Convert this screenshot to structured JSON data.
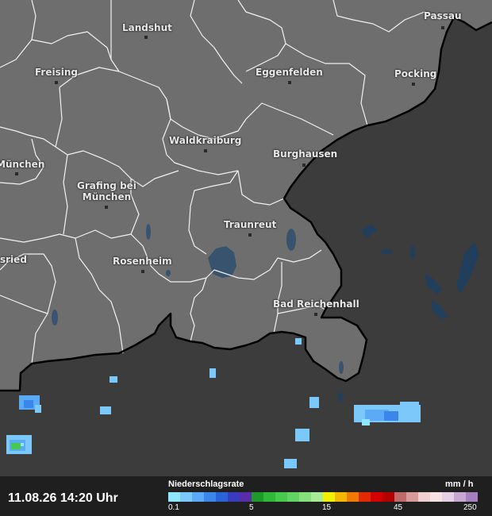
{
  "cities": [
    {
      "name": "Landshut",
      "id": "landshut"
    },
    {
      "name": "Passau",
      "id": "passau"
    },
    {
      "name": "Freising",
      "id": "freising"
    },
    {
      "name": "Eggenfelden",
      "id": "eggenfelden"
    },
    {
      "name": "Pocking",
      "id": "pocking"
    },
    {
      "name": "Waldkraiburg",
      "id": "waldkraiburg"
    },
    {
      "name": "Burghausen",
      "id": "burghausen"
    },
    {
      "name": "München",
      "id": "muenchen"
    },
    {
      "name": "Grafing bei\nMünchen",
      "id": "grafing"
    },
    {
      "name": "Traunreut",
      "id": "traunreut"
    },
    {
      "name": "Rosenheim",
      "id": "rosenheim"
    },
    {
      "name": "sried",
      "id": "sried"
    },
    {
      "name": "Bad Reichenhall",
      "id": "bad-reichenhall"
    }
  ],
  "footer": {
    "timestamp": "11.08.26 14:20 Uhr",
    "legend_title": "Niederschlagsrate",
    "legend_unit": "mm / h",
    "tick_labels": [
      "0.1",
      "5",
      "15",
      "45",
      "250"
    ],
    "swatches": [
      "#8fe6ff",
      "#7cc8fb",
      "#5aaaf5",
      "#3b86ea",
      "#2a62d9",
      "#3a3cc0",
      "#5a2ca8",
      "#1e9a2a",
      "#2fb83a",
      "#46c94c",
      "#62d464",
      "#86e07c",
      "#a8ea98",
      "#f0f000",
      "#f5b800",
      "#f27a00",
      "#e22a00",
      "#d40000",
      "#b40000",
      "#c06a6a",
      "#d89a9a",
      "#efcfcf",
      "#f6e2e2",
      "#e6d0e6",
      "#c6a8d2",
      "#a680be"
    ]
  },
  "colors": {
    "germany_fill": "#6e6e6e",
    "outside_fill": "#3c3c3c",
    "border_major": "#000000",
    "border_minor": "#ffffff",
    "water": "#2a4a6a"
  }
}
